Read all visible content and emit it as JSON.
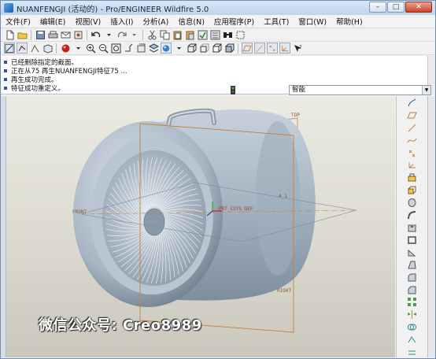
{
  "window": {
    "title": "NUANFENGJI (活动的) - Pro/ENGINEER Wildfire 5.0"
  },
  "menus": [
    "文件(F)",
    "编辑(E)",
    "视图(V)",
    "插入(I)",
    "分析(A)",
    "信息(N)",
    "应用程序(P)",
    "工具(T)",
    "窗口(W)",
    "帮助(H)"
  ],
  "messages": [
    "已经删除指定的截面。",
    "正在从75 再生NUANFENGJI特征75 ...",
    "再生成功完成。",
    "特征成功重定义。"
  ],
  "filter": {
    "value": "智能"
  },
  "graphics": {
    "datum_labels": {
      "top": "TOP",
      "front": "FRONT",
      "right": "RIGHT",
      "a1": "A_1",
      "csys": "PRT_CSYS_DEF"
    }
  },
  "watermark": "微信公众号: Creo8989",
  "colors": {
    "title_bar": "#bcd4ec",
    "graphics_bg": "#dcdad0",
    "model": "#a7b6c6",
    "datum": "#c8803a"
  }
}
